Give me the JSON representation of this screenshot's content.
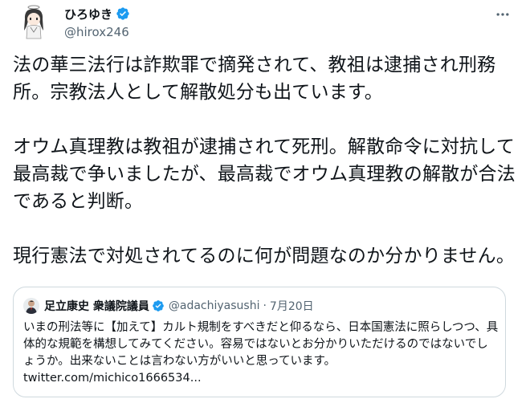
{
  "author": {
    "display_name": "ひろゆき",
    "handle": "@hirox246"
  },
  "tweet": {
    "paragraphs": [
      "法の華三法行は詐欺罪で摘発されて、教祖は逮捕され刑務所。宗教法人として解散処分も出ています。",
      "オウム真理教は教祖が逮捕されて死刑。解散命令に対抗して最高裁で争いましたが、最高裁でオウム真理教の解散が合法であると判断。",
      "現行憲法で対処されてるのに何が問題なのか分かりません。"
    ]
  },
  "quote": {
    "display_name": "足立康史 衆議院議員",
    "handle": "@adachiyasushi",
    "separator": "·",
    "date": "7月20日",
    "text": "いまの刑法等に【加えて】カルト規制をすべきだと仰るなら、日本国憲法に照らしつつ、具体的な規範を構想してみてください。容易ではないとお分かりいただけるのではないでしょうか。出来ないことは言わない方がいいと思っています。",
    "link": "twitter.com/michico1666534..."
  },
  "colors": {
    "verified": "#1d9bf0",
    "text": "#0f1419",
    "secondary": "#536471",
    "border": "#cfd9de"
  },
  "icons": {
    "verified": "verified-badge-icon",
    "more": "more-horizontal-icon"
  }
}
